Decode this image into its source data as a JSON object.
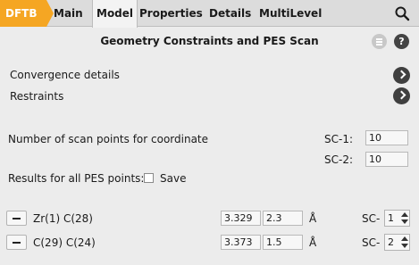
{
  "tabs": {
    "dftb": "DFTB",
    "main": "Main",
    "model": "Model",
    "properties": "Properties",
    "details": "Details",
    "multilevel": "MultiLevel"
  },
  "panel": {
    "title": "Geometry Constraints and PES Scan",
    "help": "?"
  },
  "links": {
    "convergence": "Convergence details",
    "restraints": "Restraints"
  },
  "scan": {
    "label": "Number of scan points for coordinate",
    "sc1_label": "SC-1:",
    "sc1_value": "10",
    "sc2_label": "SC-2:",
    "sc2_value": "10"
  },
  "results": {
    "label": "Results for all PES points:",
    "save_label": "Save",
    "save_checked": false
  },
  "coordinates": [
    {
      "atoms": "Zr(1) C(28)",
      "current": "3.329",
      "target": "2.3",
      "unit": "Å",
      "sc_label": "SC-",
      "sc_value": "1"
    },
    {
      "atoms": "C(29) C(24)",
      "current": "3.373",
      "target": "1.5",
      "unit": "Å",
      "sc_label": "SC-",
      "sc_value": "2"
    }
  ],
  "colors": {
    "accent": "#f5a623",
    "background": "#ececec"
  }
}
